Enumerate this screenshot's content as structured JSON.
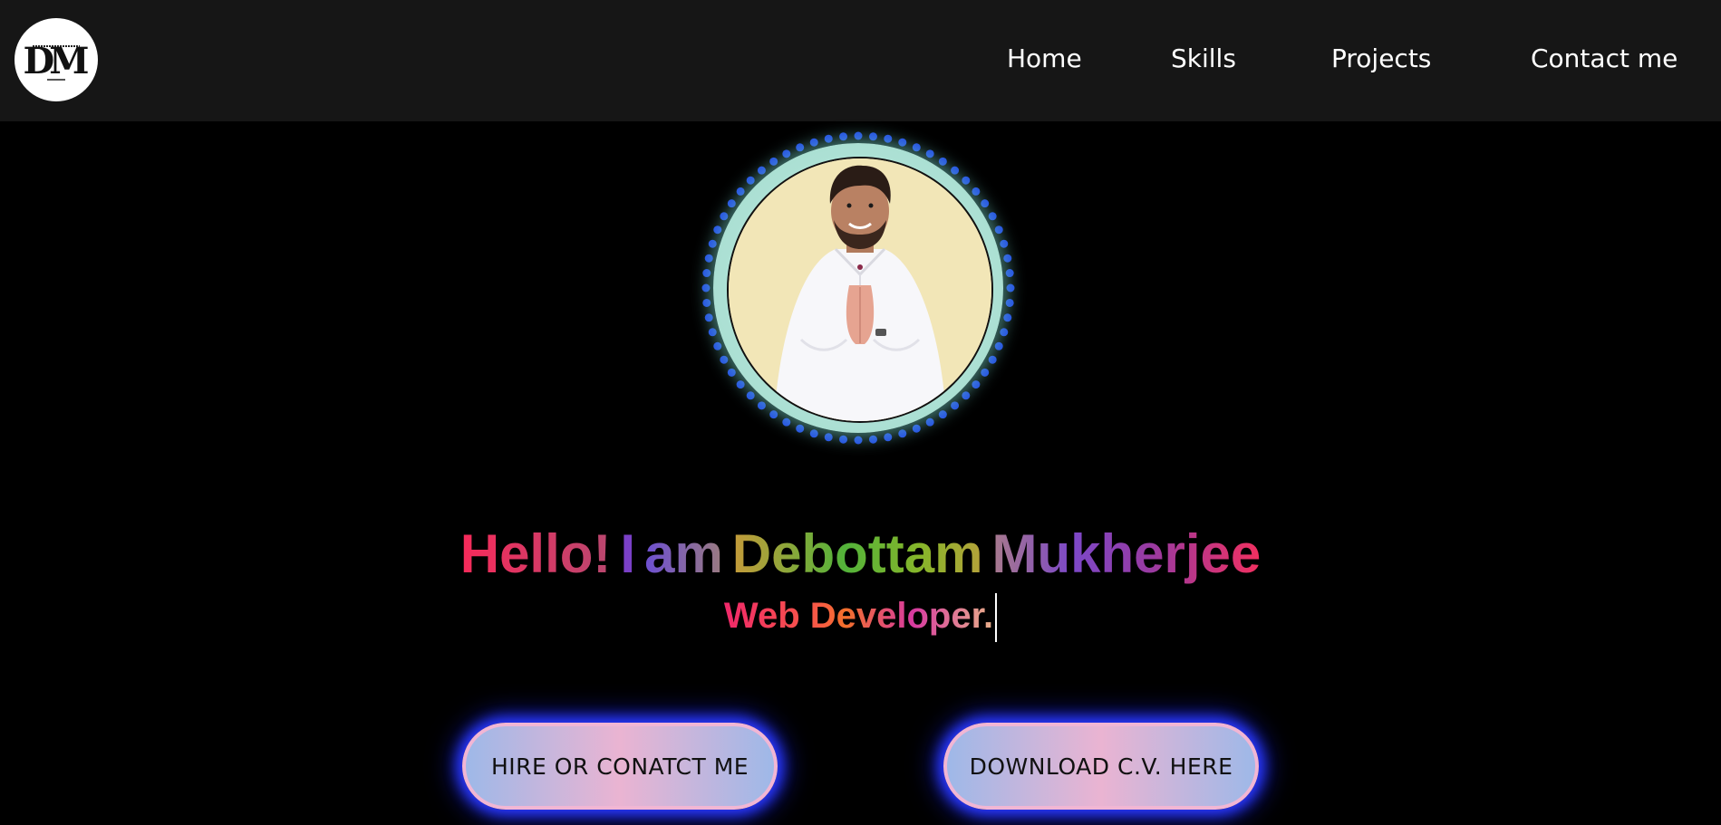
{
  "navbar": {
    "logo": {
      "initials": "DM",
      "icon": "dm-monogram-logo"
    },
    "links": [
      {
        "label": "Home"
      },
      {
        "label": "Skills"
      },
      {
        "label": "Projects"
      },
      {
        "label": "Contact me"
      }
    ]
  },
  "hero": {
    "profile_photo": {
      "icon": "profile-photo-namaste",
      "ring_color": "#1f47e8",
      "glow_color": "#a8ddd0"
    },
    "headline": {
      "words": [
        "Hello!",
        "I",
        "am",
        "Debottam",
        "Mukherjee"
      ]
    },
    "role_text": "Web Developer.",
    "buttons": {
      "hire": "HIRE OR CONATCT ME",
      "cv": "DOWNLOAD C.V. HERE"
    }
  },
  "colors": {
    "background": "#000000",
    "navbar": "#161616",
    "button_glow": "#2a39ff",
    "button_border": "#f1b6d4"
  }
}
